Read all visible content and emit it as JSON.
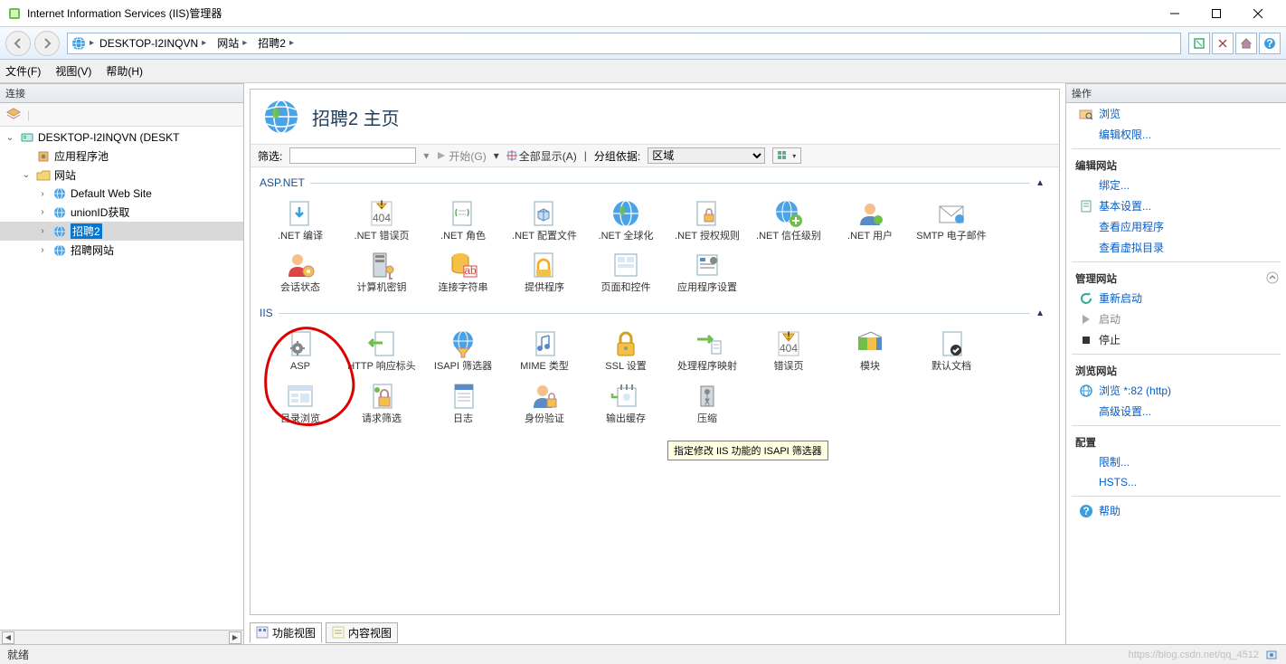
{
  "window": {
    "title": "Internet Information Services (IIS)管理器"
  },
  "breadcrumb": {
    "root_icon": "globe-icon",
    "items": [
      "DESKTOP-I2INQVN",
      "网站",
      "招聘2"
    ]
  },
  "menu": {
    "file": "文件(F)",
    "view": "视图(V)",
    "help": "帮助(H)"
  },
  "connections": {
    "header": "连接",
    "tree": {
      "server": "DESKTOP-I2INQVN (DESKT",
      "app_pools": "应用程序池",
      "sites": "网站",
      "site_list": [
        "Default Web Site",
        "unionID获取",
        "招聘2",
        "招聘网站"
      ],
      "selected_index": 2
    }
  },
  "page": {
    "title": "招聘2 主页",
    "filter": {
      "label": "筛选:",
      "go": "开始(G)",
      "show_all": "全部显示(A)",
      "group_by": "分组依据:",
      "group_value": "区域"
    },
    "groups": [
      {
        "name": "aspnet",
        "title": "ASP.NET",
        "items": [
          {
            "icon": "doc-down",
            "label": ".NET 编译"
          },
          {
            "icon": "page-404",
            "label": ".NET 错误页"
          },
          {
            "icon": "doc-script",
            "label": ".NET 角色"
          },
          {
            "icon": "doc-cube",
            "label": ".NET 配置文件"
          },
          {
            "icon": "globe",
            "label": ".NET 全球化"
          },
          {
            "icon": "doc-lock",
            "label": ".NET 授权规则"
          },
          {
            "icon": "globe-plus",
            "label": ".NET 信任级别"
          },
          {
            "icon": "user",
            "label": ".NET 用户"
          },
          {
            "icon": "mail",
            "label": "SMTP 电子邮件"
          },
          {
            "icon": "user-gear",
            "label": "会话状态"
          },
          {
            "icon": "server-key",
            "label": "计算机密钥"
          },
          {
            "icon": "db-ab",
            "label": "连接字符串"
          },
          {
            "icon": "doc-lock2",
            "label": "提供程序"
          },
          {
            "icon": "page-ctrl",
            "label": "页面和控件"
          },
          {
            "icon": "app-gear",
            "label": "应用程序设置"
          }
        ]
      },
      {
        "name": "iis",
        "title": "IIS",
        "items": [
          {
            "icon": "doc-gear",
            "label": "ASP"
          },
          {
            "icon": "doc-arrow",
            "label": "HTTP 响应标头"
          },
          {
            "icon": "globe-filter",
            "label": "ISAPI 筛选器"
          },
          {
            "icon": "music-page",
            "label": "MIME 类型"
          },
          {
            "icon": "lock",
            "label": "SSL 设置"
          },
          {
            "icon": "arrow-map",
            "label": "处理程序映射"
          },
          {
            "icon": "page-404b",
            "label": "错误页"
          },
          {
            "icon": "module",
            "label": "模块"
          },
          {
            "icon": "doc-check",
            "label": "默认文档"
          },
          {
            "icon": "browse",
            "label": "目录浏览"
          },
          {
            "icon": "lock-page",
            "label": "请求筛选"
          },
          {
            "icon": "log",
            "label": "日志"
          },
          {
            "icon": "user-lock",
            "label": "身份验证"
          },
          {
            "icon": "cache",
            "label": "输出缓存"
          },
          {
            "icon": "compress",
            "label": "压缩"
          }
        ]
      }
    ],
    "tooltip": "指定修改 IIS 功能的 ISAPI 筛选器",
    "view_tabs": {
      "features": "功能视图",
      "content": "内容视图",
      "active": "features"
    }
  },
  "actions": {
    "header": "操作",
    "explore": "浏览",
    "edit_perm": "编辑权限...",
    "edit_site": {
      "title": "编辑网站",
      "bindings": "绑定...",
      "basic": "基本设置...",
      "view_apps": "查看应用程序",
      "view_vdir": "查看虚拟目录"
    },
    "manage_site": {
      "title": "管理网站",
      "restart": "重新启动",
      "start": "启动",
      "stop": "停止"
    },
    "browse_site": {
      "title": "浏览网站",
      "browse": "浏览 *:82 (http)",
      "advanced": "高级设置..."
    },
    "config": {
      "title": "配置",
      "limits": "限制...",
      "hsts": "HSTS..."
    },
    "help": "帮助"
  },
  "status": {
    "ready": "就绪",
    "watermark": "https://blog.csdn.net/qq_4512"
  }
}
